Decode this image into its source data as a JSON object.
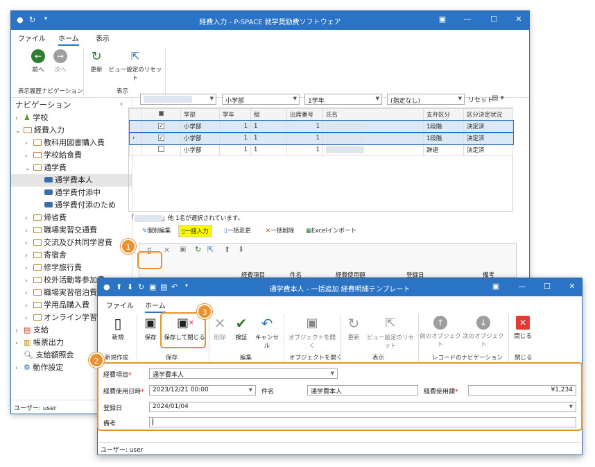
{
  "main": {
    "title": "経費入力 - P-SPACE 就学奨励費ソフトウェア",
    "menu": [
      "ファイル",
      "ホーム",
      "表示"
    ],
    "ribbon": {
      "back": "前へ",
      "forward": "次へ",
      "refresh": "更新",
      "reset_view": "ビュー設定のリセット",
      "group_history": "表示履歴ナビゲーション",
      "group_view": "表示"
    },
    "nav_title": "ナビゲーション",
    "nav_items": [
      "学校",
      "経費入力",
      "教科用図書購入費",
      "学校給食費",
      "通学費",
      "通学費本人",
      "通学費付添中",
      "通学費付添のため",
      "帰省費",
      "職場実習交通費",
      "交流及び共同学習費",
      "寄宿舎",
      "修学旅行費",
      "校外活動等参加費",
      "職場実習宿泊費",
      "学用品購入費",
      "オンライン学習通信費",
      "支給",
      "帳票出力",
      "支給額照会",
      "動作設定"
    ],
    "status": "ユーザー: user",
    "filters": {
      "dept": "小学部",
      "grade": "1学年",
      "category": "(指定なし)",
      "reset": "リセット"
    },
    "grid": {
      "headers": [
        "",
        "学部",
        "学年",
        "組",
        "出席番号",
        "氏名",
        "支弁区分",
        "区分決定状況"
      ],
      "rows": [
        {
          "checked": "✓",
          "dept": "小学部",
          "grade": "1",
          "cls": "1",
          "no": "1",
          "level": "1段階",
          "status": "決定済"
        },
        {
          "checked": "✓",
          "dept": "小学部",
          "grade": "1",
          "cls": "1",
          "no": "1",
          "level": "1段階",
          "status": "決定済"
        },
        {
          "checked": "",
          "dept": "小学部",
          "grade": "1",
          "cls": "1",
          "no": "1",
          "level": "辞退",
          "status": "決定済"
        }
      ]
    },
    "selection_info": "他 1名が選択されています。",
    "subtabs": [
      "個別編集",
      "一括入力",
      "一括変更",
      "一括削除",
      "Excelインポート"
    ],
    "subgrid_headers": [
      "経費項目",
      "件名",
      "経費使用額",
      "登録日",
      "備考"
    ]
  },
  "dialog": {
    "title": "通学費本人 - 一括追加 経費明細テンプレート",
    "menu": [
      "ファイル",
      "ホーム"
    ],
    "ribbon": {
      "new": "新規",
      "save": "保存",
      "save_close": "保存して閉じる",
      "delete": "削除",
      "validate": "検証",
      "cancel": "キャンセル",
      "open_object": "オブジェクトを開く",
      "refresh": "更新",
      "reset_view": "ビュー設定のリセット",
      "prev_object": "前のオブジェクト",
      "next_object": "次のオブジェクト",
      "close": "閉じる",
      "groups": [
        "新規作成",
        "保存",
        "編集",
        "オブジェクトを開く",
        "表示",
        "レコードのナビゲーション",
        "閉じる"
      ]
    },
    "form": {
      "expense_item_label": "経費項目",
      "expense_item_value": "通学費本人",
      "use_date_label": "経費使用日時",
      "use_date_value": "2023/12/21 00:00",
      "subject_label": "件名",
      "subject_value": "通学費本人",
      "amount_label": "経費使用額",
      "amount_value": "¥1,234",
      "reg_date_label": "登録日",
      "reg_date_value": "2024/01/04",
      "note_label": "備考",
      "note_value": ""
    },
    "status": "ユーザー: user"
  },
  "callouts": [
    "1",
    "2",
    "3"
  ],
  "colors": {
    "titlebar": "#2b73c4",
    "callout": "#e8912d",
    "highlight": "#fff700"
  }
}
